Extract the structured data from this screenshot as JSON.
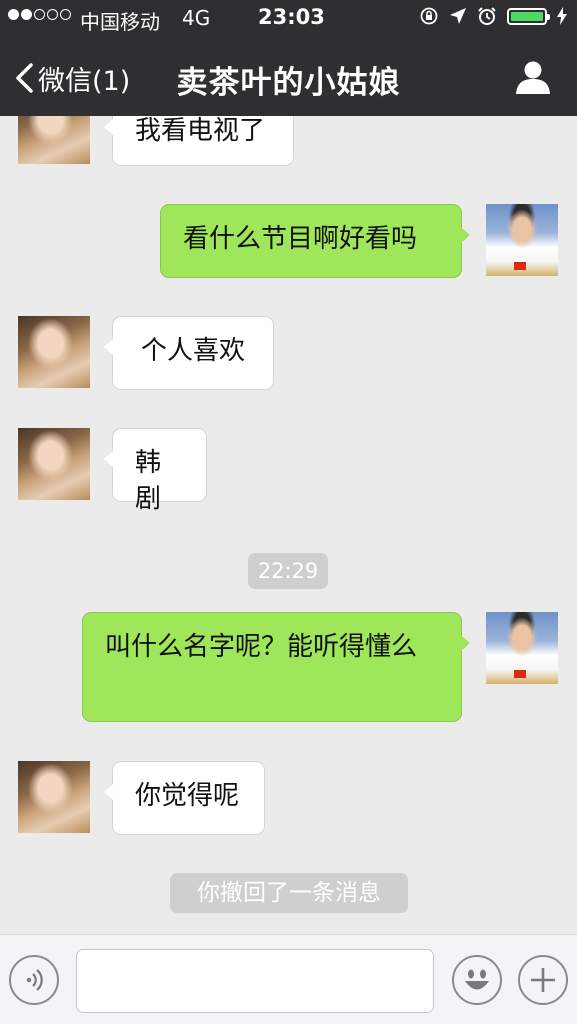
{
  "status_bar": {
    "carrier": "中国移动",
    "network": "4G",
    "time": "23:03"
  },
  "nav": {
    "back_label": "微信(1)",
    "title": "卖茶叶的小姑娘"
  },
  "messages": [
    {
      "side": "in",
      "text": "我看电视了"
    },
    {
      "side": "out",
      "text": "看什么节目啊好看吗"
    },
    {
      "side": "in",
      "text": "个人喜欢"
    },
    {
      "side": "in",
      "text": "韩剧"
    },
    {
      "side": "out",
      "text": "叫什么名字呢？能听得懂么"
    },
    {
      "side": "in",
      "text": "你觉得呢"
    }
  ],
  "timestamp": "22:29",
  "system_notice": "你撤回了一条消息",
  "colors": {
    "nav_bg": "#2f2f31",
    "outgoing_bubble": "#9fe65a",
    "incoming_bubble": "#ffffff",
    "chat_bg": "#ebebeb",
    "battery": "#4cd964"
  },
  "icons": [
    "chevron-left-icon",
    "person-icon",
    "voice-icon",
    "emoji-icon",
    "plus-icon",
    "orientation-lock-icon",
    "location-arrow-icon",
    "alarm-icon",
    "charging-icon"
  ]
}
